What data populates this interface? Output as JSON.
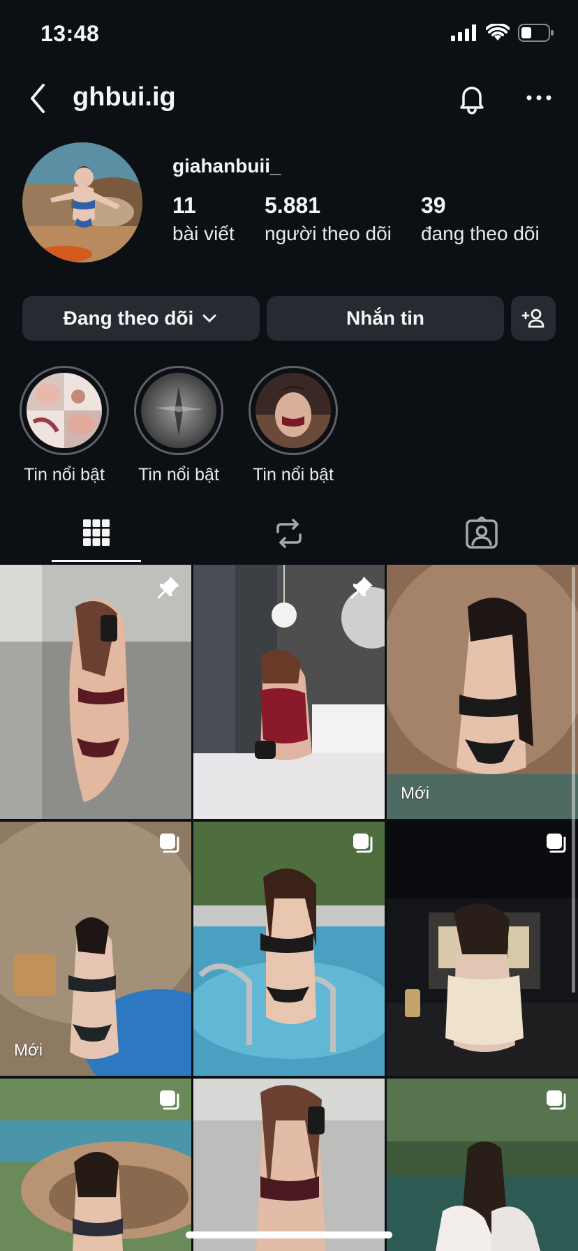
{
  "status_bar": {
    "time": "13:48"
  },
  "header": {
    "title": "ghbui.ig"
  },
  "profile": {
    "name": "giahanbuii_",
    "stats": [
      {
        "value": "11",
        "label": "bài viết"
      },
      {
        "value": "5.881",
        "label": "người theo dõi"
      },
      {
        "value": "39",
        "label": "đang theo dõi"
      }
    ]
  },
  "actions": {
    "following_label": "Đang theo dõi",
    "message_label": "Nhắn tin"
  },
  "highlights": [
    {
      "label": "Tin nổi bật"
    },
    {
      "label": "Tin nổi bật"
    },
    {
      "label": "Tin nổi bật"
    }
  ],
  "tabs": [
    {
      "icon": "grid-icon",
      "active": true
    },
    {
      "icon": "repost-icon",
      "active": false
    },
    {
      "icon": "tagged-icon",
      "active": false
    }
  ],
  "posts": [
    {
      "badge": "pin-icon",
      "label": ""
    },
    {
      "badge": "pin-icon",
      "label": ""
    },
    {
      "badge": "",
      "label": "Mới"
    },
    {
      "badge": "carousel-icon",
      "label": "Mới"
    },
    {
      "badge": "carousel-icon",
      "label": ""
    },
    {
      "badge": "carousel-icon",
      "label": ""
    },
    {
      "badge": "carousel-icon",
      "label": ""
    },
    {
      "badge": "",
      "label": ""
    },
    {
      "badge": "carousel-icon",
      "label": ""
    }
  ],
  "colors": {
    "background": "#0c1014",
    "button": "#262a31",
    "text": "#f5f5f5"
  }
}
